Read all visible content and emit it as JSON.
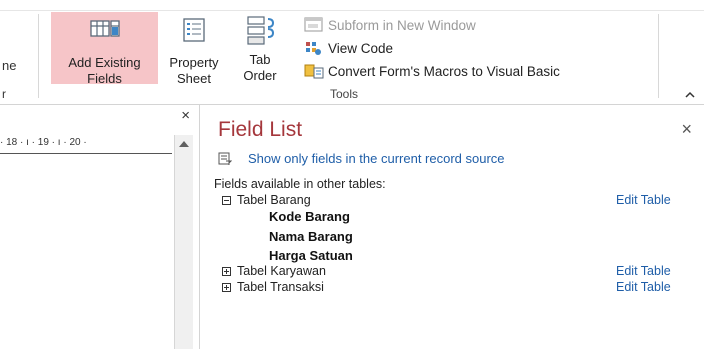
{
  "ribbon": {
    "left_cut_label": "ne",
    "left_cut_group": "r",
    "add_existing_fields": {
      "line1": "Add Existing",
      "line2": "Fields"
    },
    "property_sheet": {
      "line1": "Property",
      "line2": "Sheet"
    },
    "tab_order": {
      "line1": "Tab",
      "line2": "Order"
    },
    "subform_new_window": "Subform in New Window",
    "view_code": "View Code",
    "convert_macros": "Convert Form's Macros to Visual Basic",
    "group_label": "Tools",
    "collapse_icon": "chevron-up-icon"
  },
  "left_pane": {
    "close_glyph": "×",
    "ruler_text": "· 18 · ı · 19 · ı · 20 ·"
  },
  "field_list": {
    "title": "Field List",
    "close_glyph": "×",
    "show_only_label": "Show only fields in the current record source",
    "available_label": "Fields available in other tables:",
    "tables": [
      {
        "name": "Tabel Barang",
        "expanded": true,
        "edit_label": "Edit Table",
        "fields": [
          "Kode Barang",
          "Nama Barang",
          "Harga Satuan"
        ]
      },
      {
        "name": "Tabel Karyawan",
        "expanded": false,
        "edit_label": "Edit Table",
        "fields": []
      },
      {
        "name": "Tabel Transaksi",
        "expanded": false,
        "edit_label": "Edit Table",
        "fields": []
      }
    ]
  },
  "colors": {
    "title_red": "#a5373c",
    "link_blue": "#1f5ea8",
    "active_pink": "#f6c5c8"
  }
}
